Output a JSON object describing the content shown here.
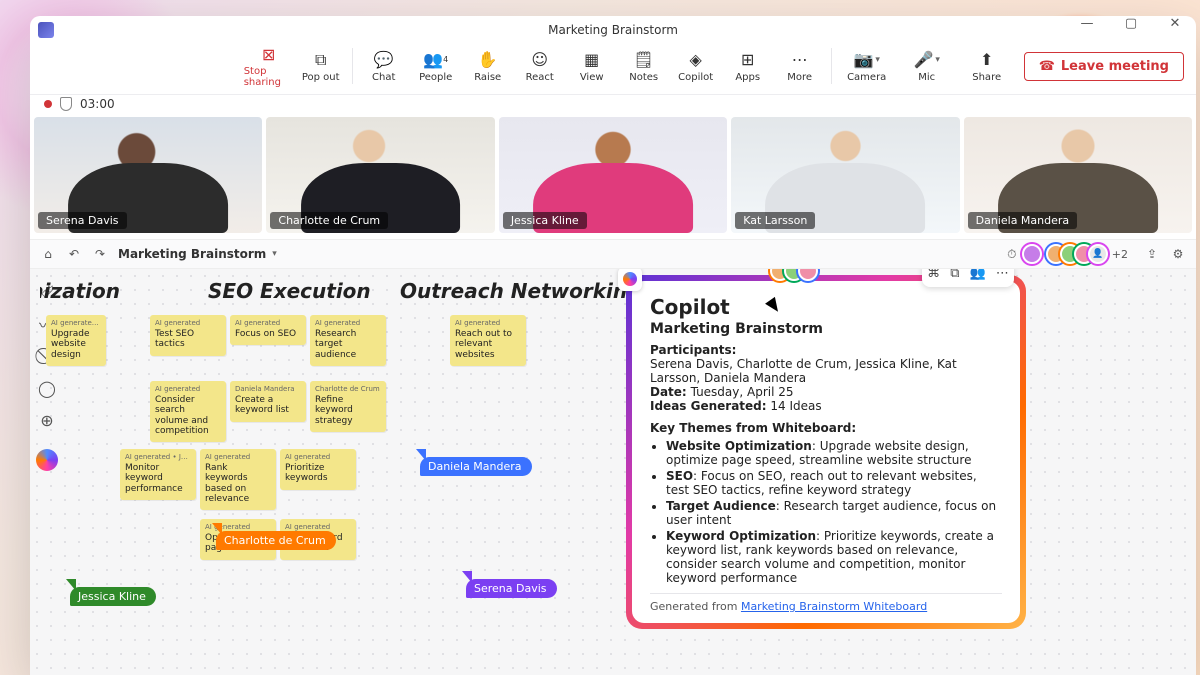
{
  "window": {
    "title": "Marketing Brainstorm",
    "timer": "03:00"
  },
  "toolbar": {
    "stop_sharing": "Stop sharing",
    "pop_out": "Pop out",
    "chat": "Chat",
    "people": "People",
    "people_count": "4",
    "raise": "Raise",
    "react": "React",
    "view": "View",
    "notes": "Notes",
    "copilot": "Copilot",
    "apps": "Apps",
    "more": "More",
    "camera": "Camera",
    "mic": "Mic",
    "share": "Share",
    "leave": "Leave meeting"
  },
  "participants": [
    {
      "name": "Serena Davis"
    },
    {
      "name": "Charlotte de Crum"
    },
    {
      "name": "Jessica Kline"
    },
    {
      "name": "Kat Larsson"
    },
    {
      "name": "Daniela Mandera"
    }
  ],
  "whiteboard": {
    "title": "Marketing Brainstorm",
    "overflow": "+2",
    "columns": [
      {
        "title": "Optimization"
      },
      {
        "title": "SEO Execution"
      },
      {
        "title": "Outreach Networking"
      }
    ],
    "stickies": {
      "s1": {
        "author": "AI generated • Serena Davis",
        "text": "Upgrade website design"
      },
      "s2": {
        "author": "AI generated",
        "text": "Test SEO tactics"
      },
      "s3": {
        "author": "AI generated",
        "text": "Focus on SEO"
      },
      "s4": {
        "author": "AI generated",
        "text": "Research target audience"
      },
      "s5": {
        "author": "AI generated",
        "text": "Reach out to relevant websites"
      },
      "s6": {
        "author": "AI generated",
        "text": "Consider search volume and competition"
      },
      "s7": {
        "author": "Daniela Mandera",
        "text": "Create a keyword list"
      },
      "s8": {
        "author": "Charlotte de Crum",
        "text": "Refine keyword strategy"
      },
      "s9": {
        "author": "AI generated • Jessica Kline",
        "text": "Monitor keyword performance"
      },
      "s10": {
        "author": "AI generated",
        "text": "Rank keywords based on relevance"
      },
      "s11": {
        "author": "AI generated",
        "text": "Prioritize keywords"
      },
      "s12": {
        "author": "AI generated",
        "text": "Optimize on-page content"
      },
      "s13": {
        "author": "AI generated",
        "text": "Use keyword variations"
      }
    },
    "cursors": {
      "blue": "Daniela Mandera",
      "orange": "Charlotte de Crum",
      "purple": "Serena Davis",
      "green": "Jessica Kline"
    }
  },
  "copilot": {
    "heading": "Copilot",
    "subheading": "Marketing Brainstorm",
    "participants_label": "Participants:",
    "participants": "Serena Davis, Charlotte de Crum, Jessica Kline, Kat Larsson, Daniela Mandera",
    "date_label": "Date:",
    "date": "Tuesday, April 25",
    "ideas_label": "Ideas Generated:",
    "ideas": "14 Ideas",
    "themes_heading": "Key Themes from Whiteboard:",
    "themes": [
      {
        "k": "Website Optimization",
        "v": "Upgrade website design, optimize page speed, streamline website structure"
      },
      {
        "k": "SEO",
        "v": "Focus on SEO, reach out to relevant websites, test SEO tactics, refine keyword strategy"
      },
      {
        "k": "Target Audience",
        "v": "Research target audience, focus on user intent"
      },
      {
        "k": "Keyword Optimization",
        "v": "Prioritize keywords, create a keyword list, rank keywords based on relevance, consider search volume and competition, monitor keyword performance"
      }
    ],
    "generated_prefix": "Generated from ",
    "generated_link": "Marketing Brainstorm Whiteboard"
  }
}
